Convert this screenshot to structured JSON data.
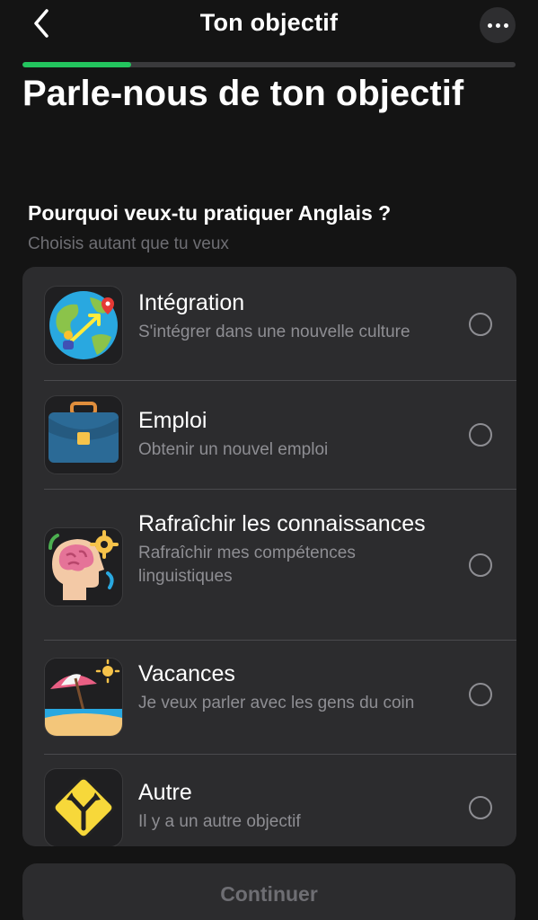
{
  "header": {
    "title": "Ton objectif",
    "back_icon": "chevron-left-icon",
    "more_icon": "more-horizontal-icon"
  },
  "progress": {
    "value_percent": 22,
    "color": "#23c55e"
  },
  "headline": "Parle-nous de ton objectif",
  "question": "Pourquoi veux-tu pratiquer Anglais ?",
  "hint": "Choisis autant que tu veux",
  "options": [
    {
      "icon": "globe-integration-icon",
      "title": "Intégration",
      "subtitle": "S'intégrer dans une nouvelle culture",
      "selected": false
    },
    {
      "icon": "briefcase-icon",
      "title": "Emploi",
      "subtitle": "Obtenir un nouvel emploi",
      "selected": false
    },
    {
      "icon": "brain-gear-icon",
      "title": "Rafraîchir les connaissances",
      "subtitle": "Rafraîchir mes compétences linguistiques",
      "selected": false
    },
    {
      "icon": "beach-umbrella-icon",
      "title": "Vacances",
      "subtitle": "Je veux parler avec les gens du coin",
      "selected": false
    },
    {
      "icon": "road-sign-icon",
      "title": "Autre",
      "subtitle": "Il y a un autre objectif",
      "selected": false
    }
  ],
  "continue_label": "Continuer"
}
